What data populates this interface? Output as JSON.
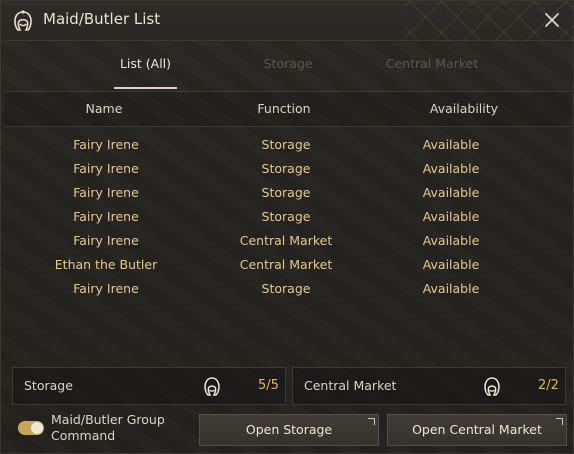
{
  "window": {
    "title": "Maid/Butler List",
    "title_icon": "maid-icon",
    "close_icon": "close-icon"
  },
  "tabs": [
    {
      "label": "List (All)",
      "active": true
    },
    {
      "label": "Storage",
      "active": false
    },
    {
      "label": "Central Market",
      "active": false
    }
  ],
  "list": {
    "headers": [
      "Name",
      "Function",
      "Availability"
    ],
    "rows": [
      {
        "name": "Fairy Irene",
        "function": "Storage",
        "availability": "Available"
      },
      {
        "name": "Fairy Irene",
        "function": "Storage",
        "availability": "Available"
      },
      {
        "name": "Fairy Irene",
        "function": "Storage",
        "availability": "Available"
      },
      {
        "name": "Fairy Irene",
        "function": "Storage",
        "availability": "Available"
      },
      {
        "name": "Fairy Irene",
        "function": "Central Market",
        "availability": "Available"
      },
      {
        "name": "Ethan the Butler",
        "function": "Central Market",
        "availability": "Available"
      },
      {
        "name": "Fairy Irene",
        "function": "Storage",
        "availability": "Available"
      }
    ]
  },
  "summary": {
    "storage": {
      "label": "Storage",
      "count": "5/5",
      "icon": "maid-icon"
    },
    "market": {
      "label": "Central Market",
      "count": "2/2",
      "icon": "maid-icon"
    }
  },
  "footer": {
    "group_command_label": "Maid/Butler Group Command",
    "group_command_on": true,
    "open_storage_label": "Open Storage",
    "open_market_label": "Open Central Market"
  },
  "colors": {
    "accent_gold": "#e0b55a",
    "row_text": "#e7c88c",
    "toggle_on": "#c7a65b"
  }
}
